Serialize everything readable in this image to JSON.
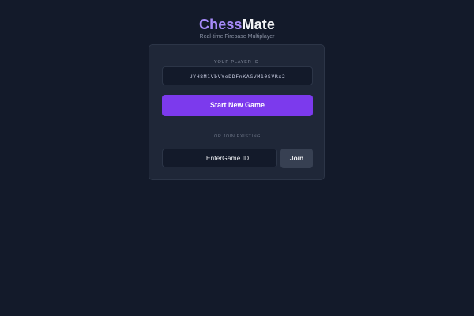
{
  "brand": {
    "title_part1": "Chess",
    "title_part2": "Mate",
    "subtitle": "Real-time Firebase Multiplayer"
  },
  "player": {
    "label": "YOUR PLAYER ID",
    "id": "UYH8M1VbVYeDDFnKAGVM10SVRx2"
  },
  "actions": {
    "start_label": "Start New Game",
    "divider_text": "OR JOIN EXISTING",
    "game_id_placeholder": "EnterGame ID",
    "join_label": "Join"
  },
  "colors": {
    "background": "#131a2a",
    "card": "#1f2738",
    "accent": "#7c3aed",
    "brand_accent": "#a78bfa"
  }
}
